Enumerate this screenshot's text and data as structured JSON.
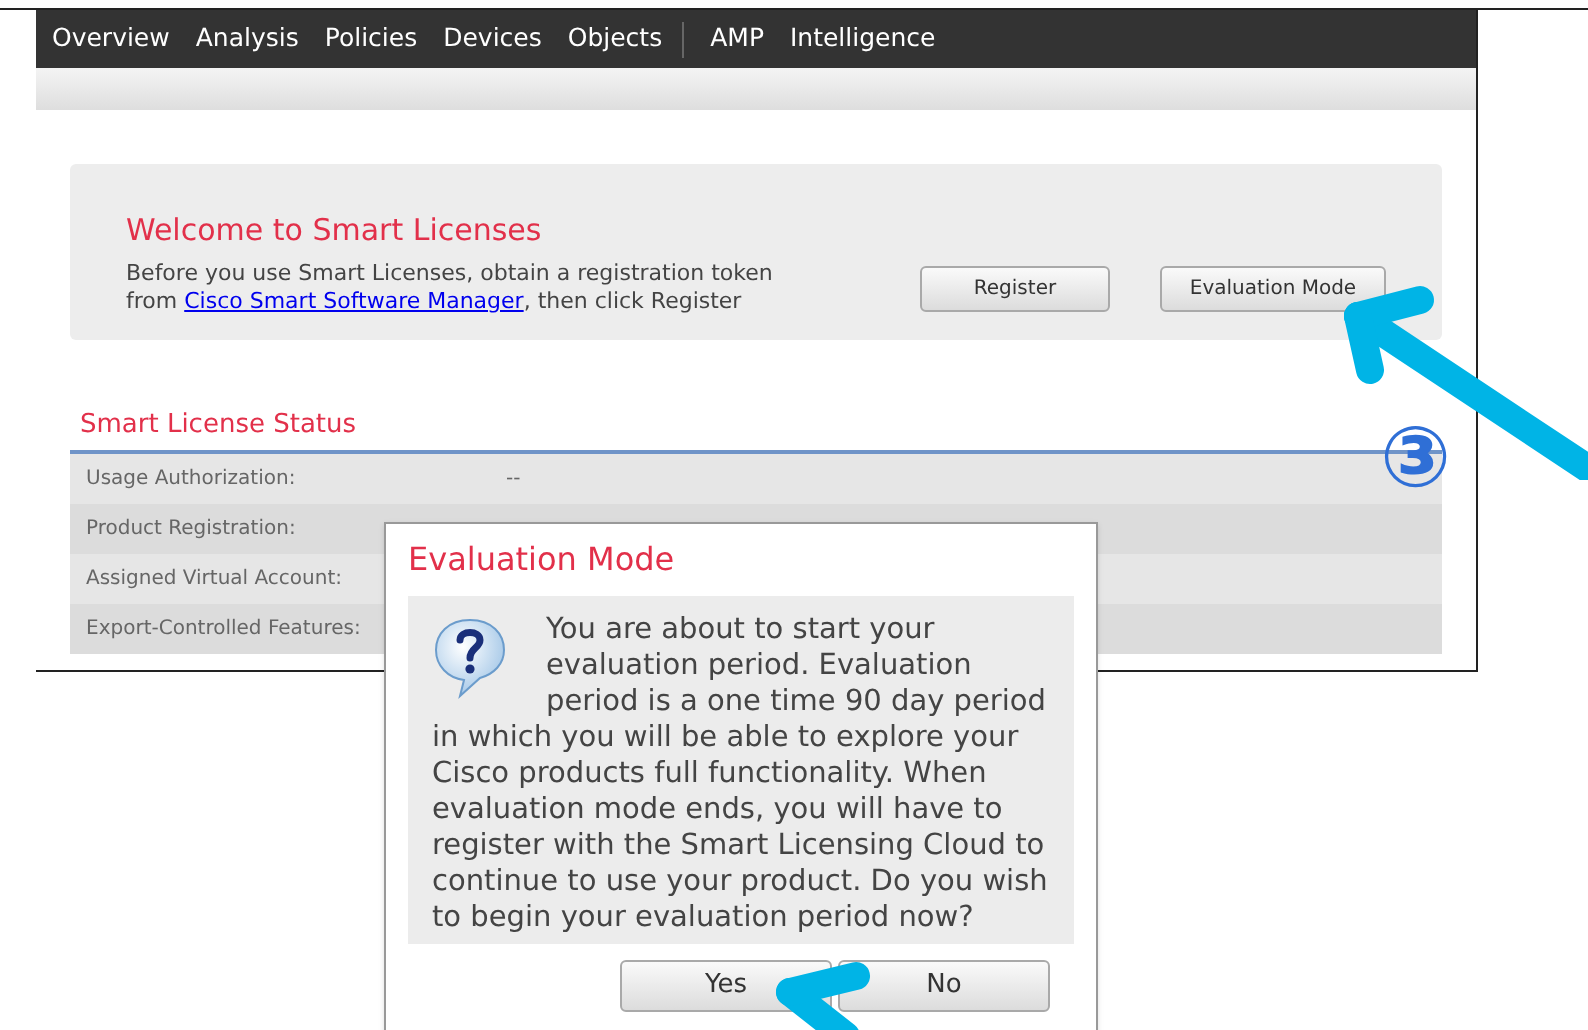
{
  "nav": {
    "groups": [
      [
        "Overview",
        "Analysis",
        "Policies",
        "Devices",
        "Objects"
      ],
      [
        "AMP",
        "Intelligence"
      ]
    ]
  },
  "welcome": {
    "title": "Welcome to Smart Licenses",
    "text_before": "Before you use Smart Licenses, obtain a registration token from ",
    "link": "Cisco Smart Software Manager",
    "text_after": ", then click Register",
    "buttons": [
      "Register",
      "Evaluation Mode"
    ]
  },
  "status": {
    "title": "Smart License Status",
    "rows": [
      {
        "label": "Usage Authorization:",
        "value": "--"
      },
      {
        "label": "Product Registration:"
      },
      {
        "label": "Assigned Virtual Account:"
      },
      {
        "label": "Export-Controlled Features:"
      }
    ]
  },
  "dialog": {
    "title": "Evaluation Mode",
    "message_lead": "You are about to start your evaluation period. Evaluation period is a one time 90 day period",
    "message_rest": "in which you will be able to explore your Cisco products full functionality. When evaluation mode ends, you will have to register with the Smart Licensing Cloud to continue to use your product. Do you wish to begin your evaluation period now?",
    "buttons": [
      "Yes",
      "No"
    ]
  },
  "step_marker": "③"
}
